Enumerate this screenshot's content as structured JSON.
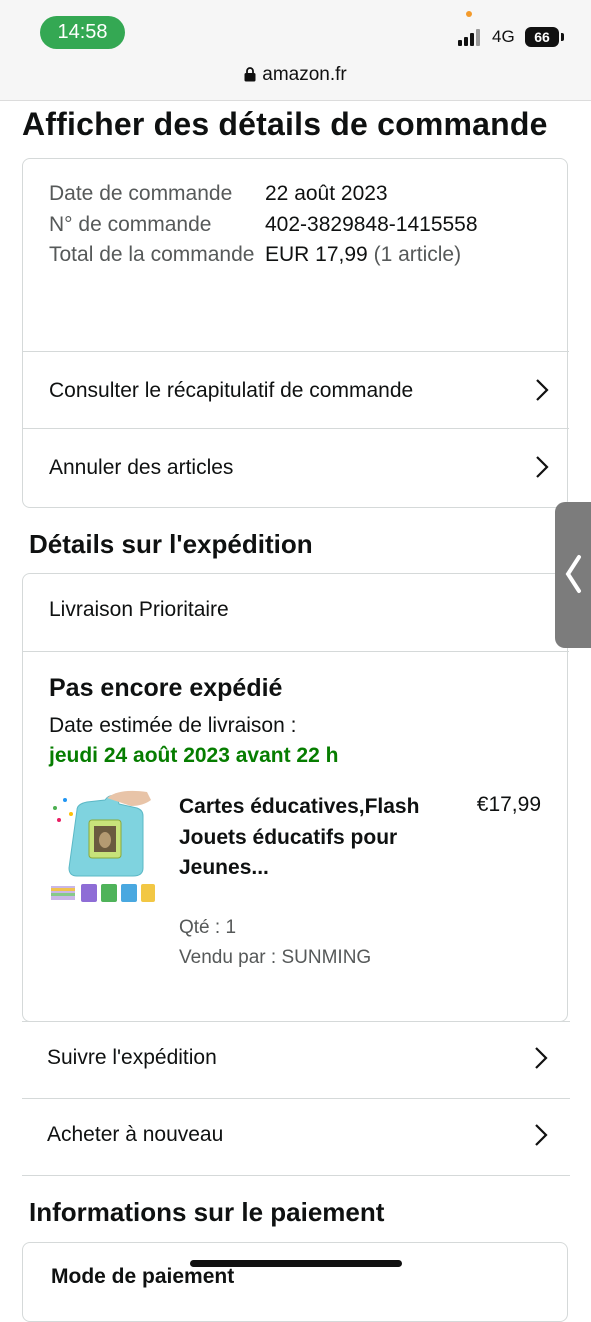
{
  "status_bar": {
    "time": "14:58",
    "network": "4G",
    "battery": "66"
  },
  "browser": {
    "url": "amazon.fr",
    "icon": "lock-icon"
  },
  "page": {
    "title": "Afficher des détails de commande"
  },
  "order_summary": {
    "rows": [
      {
        "label": "Date de commande",
        "value": "22 août 2023"
      },
      {
        "label": "N° de commande",
        "value": "402-3829848-1415558"
      },
      {
        "label": "Total de la commande",
        "value": "EUR 17,99",
        "extra": "(1 article)"
      }
    ],
    "links": [
      {
        "label": "Consulter le récapitulatif de commande",
        "icon": "chevron-right-icon"
      },
      {
        "label": "Annuler des articles",
        "icon": "chevron-right-icon"
      }
    ]
  },
  "shipping": {
    "heading": "Détails sur l'expédition",
    "method": "Livraison Prioritaire",
    "status": "Pas encore expédié",
    "estimate_label": "Date estimée de livraison :",
    "estimate_date": "jeudi 24 août 2023 avant 22 h",
    "date_color": "#067d00",
    "item": {
      "title": "Cartes éducatives,Flash Jouets éducatifs pour Jeunes...",
      "price": "€17,99",
      "quantity": "Qté : 1",
      "seller": "Vendu par : SUNMING"
    },
    "actions": [
      {
        "label": "Suivre l'expédition",
        "icon": "chevron-right-icon"
      },
      {
        "label": "Acheter à nouveau",
        "icon": "chevron-right-icon"
      }
    ]
  },
  "payment": {
    "heading": "Informations sur le paiement",
    "method_label": "Mode de paiement"
  }
}
